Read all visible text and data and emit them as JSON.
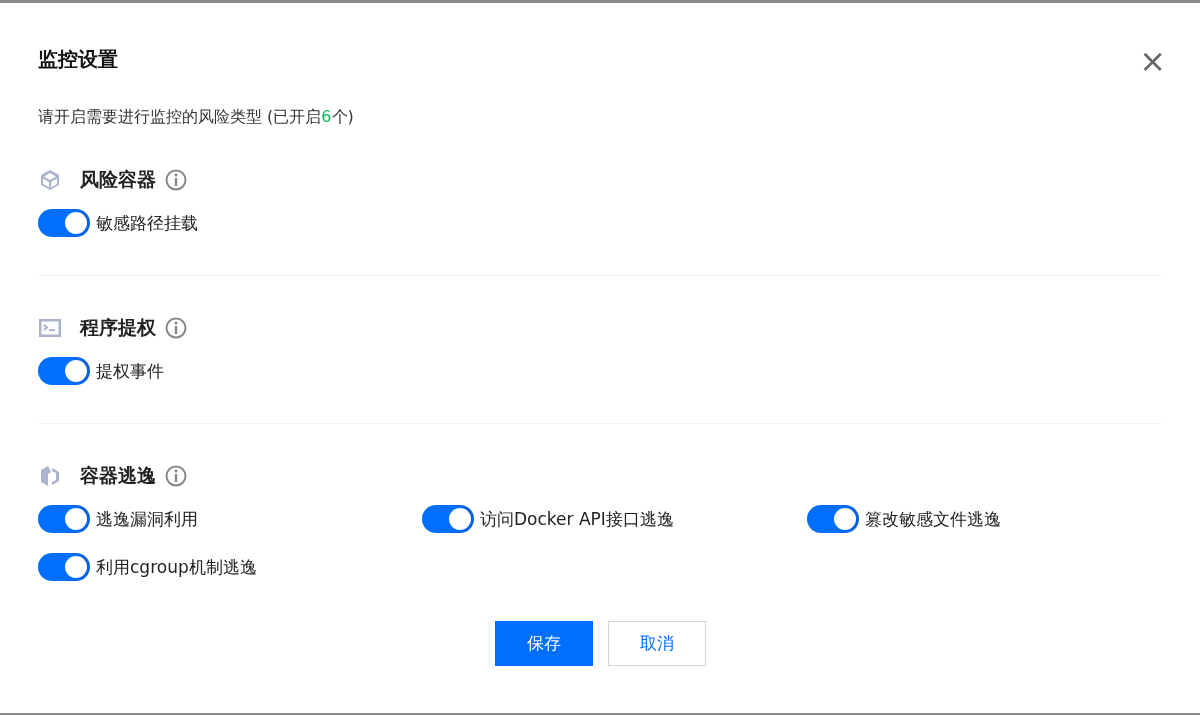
{
  "dialog": {
    "title": "监控设置",
    "close": "×"
  },
  "subtitle": {
    "before": "请开启需要进行监控的风险类型 (已开启",
    "count": "6",
    "after": "个)"
  },
  "sections": [
    {
      "kind": "cube",
      "title": "风险容器",
      "items": [
        {
          "label": "敏感路径挂载",
          "on": true
        }
      ]
    },
    {
      "kind": "terminal",
      "title": "程序提权",
      "items": [
        {
          "label": "提权事件",
          "on": true
        }
      ]
    },
    {
      "kind": "escape",
      "title": "容器逃逸",
      "items": [
        {
          "label": "逃逸漏洞利用",
          "on": true
        },
        {
          "label": "访问Docker API接口逃逸",
          "on": true
        },
        {
          "label": "篡改敏感文件逃逸",
          "on": true
        },
        {
          "label": "利用cgroup机制逃逸",
          "on": true
        }
      ]
    }
  ],
  "buttons": [
    {
      "label": "保存",
      "kind": "primary"
    },
    {
      "label": "取消",
      "kind": "secondary"
    }
  ]
}
